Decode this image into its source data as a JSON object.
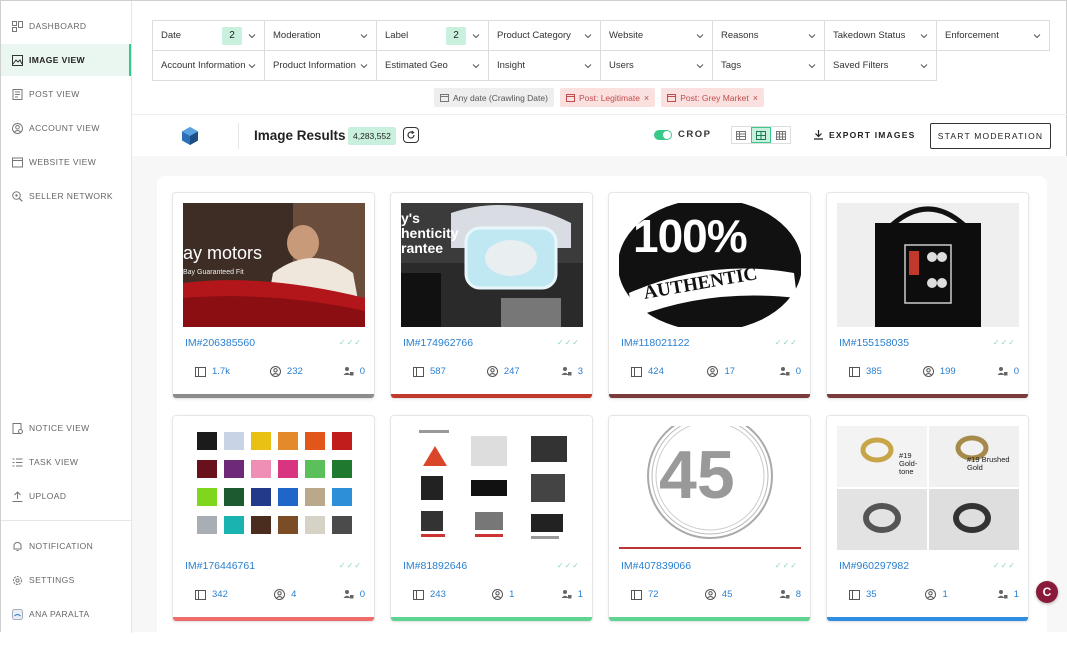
{
  "sidebar": {
    "items": [
      {
        "label": "Dashboard",
        "icon": "dashboard-icon",
        "active": false
      },
      {
        "label": "Image View",
        "icon": "image-icon",
        "active": true
      },
      {
        "label": "Post View",
        "icon": "post-icon",
        "active": false
      },
      {
        "label": "Account View",
        "icon": "account-icon",
        "active": false
      },
      {
        "label": "Website View",
        "icon": "website-icon",
        "active": false
      },
      {
        "label": "Seller Network",
        "icon": "network-icon",
        "active": false
      }
    ],
    "bottom_items": [
      {
        "label": "Notice View",
        "icon": "notice-icon"
      },
      {
        "label": "Task View",
        "icon": "task-icon"
      },
      {
        "label": "Upload",
        "icon": "upload-icon"
      }
    ],
    "footer_items": [
      {
        "label": "Notification",
        "icon": "bell-icon"
      },
      {
        "label": "Settings",
        "icon": "gear-icon"
      },
      {
        "label": "Ana Paralta",
        "icon": "avatar"
      }
    ]
  },
  "filters": {
    "row1": [
      {
        "label": "Date",
        "count": "2"
      },
      {
        "label": "Moderation",
        "count": ""
      },
      {
        "label": "Label",
        "count": "2"
      },
      {
        "label": "Product Category",
        "count": ""
      },
      {
        "label": "Website",
        "count": ""
      },
      {
        "label": "Reasons",
        "count": ""
      },
      {
        "label": "Takedown Status",
        "count": ""
      },
      {
        "label": "Enforcement",
        "count": ""
      }
    ],
    "row2": [
      {
        "label": "Account Information"
      },
      {
        "label": "Product Information"
      },
      {
        "label": "Estimated Geo"
      },
      {
        "label": "Insight"
      },
      {
        "label": "Users"
      },
      {
        "label": "Tags"
      },
      {
        "label": "Saved Filters"
      }
    ],
    "active_chips": [
      {
        "label": "Any date (Crawling Date)",
        "style": "neutral",
        "removable": false
      },
      {
        "label": "Post: Legitimate",
        "style": "red",
        "removable": true
      },
      {
        "label": "Post: Grey Market",
        "style": "red",
        "removable": true
      }
    ]
  },
  "results": {
    "title": "Image Results",
    "count": "4,283,552",
    "crop_label": "CROP",
    "crop_enabled": true,
    "export_label": "EXPORT IMAGES",
    "start_label": "START MODERATION"
  },
  "cards": [
    {
      "id": "IM#206385560",
      "views": "1.7k",
      "users": "232",
      "accounts": "0",
      "bar_color": "#8c8c8c",
      "thumb": "car-ebay"
    },
    {
      "id": "IM#174962766",
      "views": "587",
      "users": "247",
      "accounts": "3",
      "bar_color": "#c0392b",
      "thumb": "authenticity-device"
    },
    {
      "id": "IM#118021122",
      "views": "424",
      "users": "17",
      "accounts": "0",
      "bar_color": "#7a3b3b",
      "thumb": "100-authentic"
    },
    {
      "id": "IM#155158035",
      "views": "385",
      "users": "199",
      "accounts": "0",
      "bar_color": "#7a3b3b",
      "thumb": "tote-bag"
    },
    {
      "id": "IM#176446761",
      "views": "342",
      "users": "4",
      "accounts": "0",
      "bar_color": "#f06b6b",
      "thumb": "color-swatches"
    },
    {
      "id": "IM#81892646",
      "views": "243",
      "users": "1",
      "accounts": "1",
      "bar_color": "#5fd391",
      "thumb": "product-catalog"
    },
    {
      "id": "IM#407839066",
      "views": "72",
      "users": "45",
      "accounts": "8",
      "bar_color": "#5fd391",
      "thumb": "number-45"
    },
    {
      "id": "IM#960297982",
      "views": "35",
      "users": "1",
      "accounts": "1",
      "bar_color": "#2f8de4",
      "thumb": "swivel-clasps"
    }
  ],
  "thumb_text": {
    "car_brand": "ay motors",
    "car_sub": "Bay Guaranteed Fit",
    "auth_line1": "y's",
    "auth_line2": "henticity",
    "auth_line3": "rantee",
    "stamp_main": "100%",
    "stamp_sub": "AUTHENTIC",
    "big_number": "45",
    "clasp_a": "#19 Gold-tone",
    "clasp_b": "#19 Brushed Gold"
  },
  "fab_label": "C",
  "colors": {
    "accent": "#38c98a",
    "accent_light": "#c9f0dd",
    "link": "#2a7fcf",
    "chip_red": "#c24b4b"
  }
}
